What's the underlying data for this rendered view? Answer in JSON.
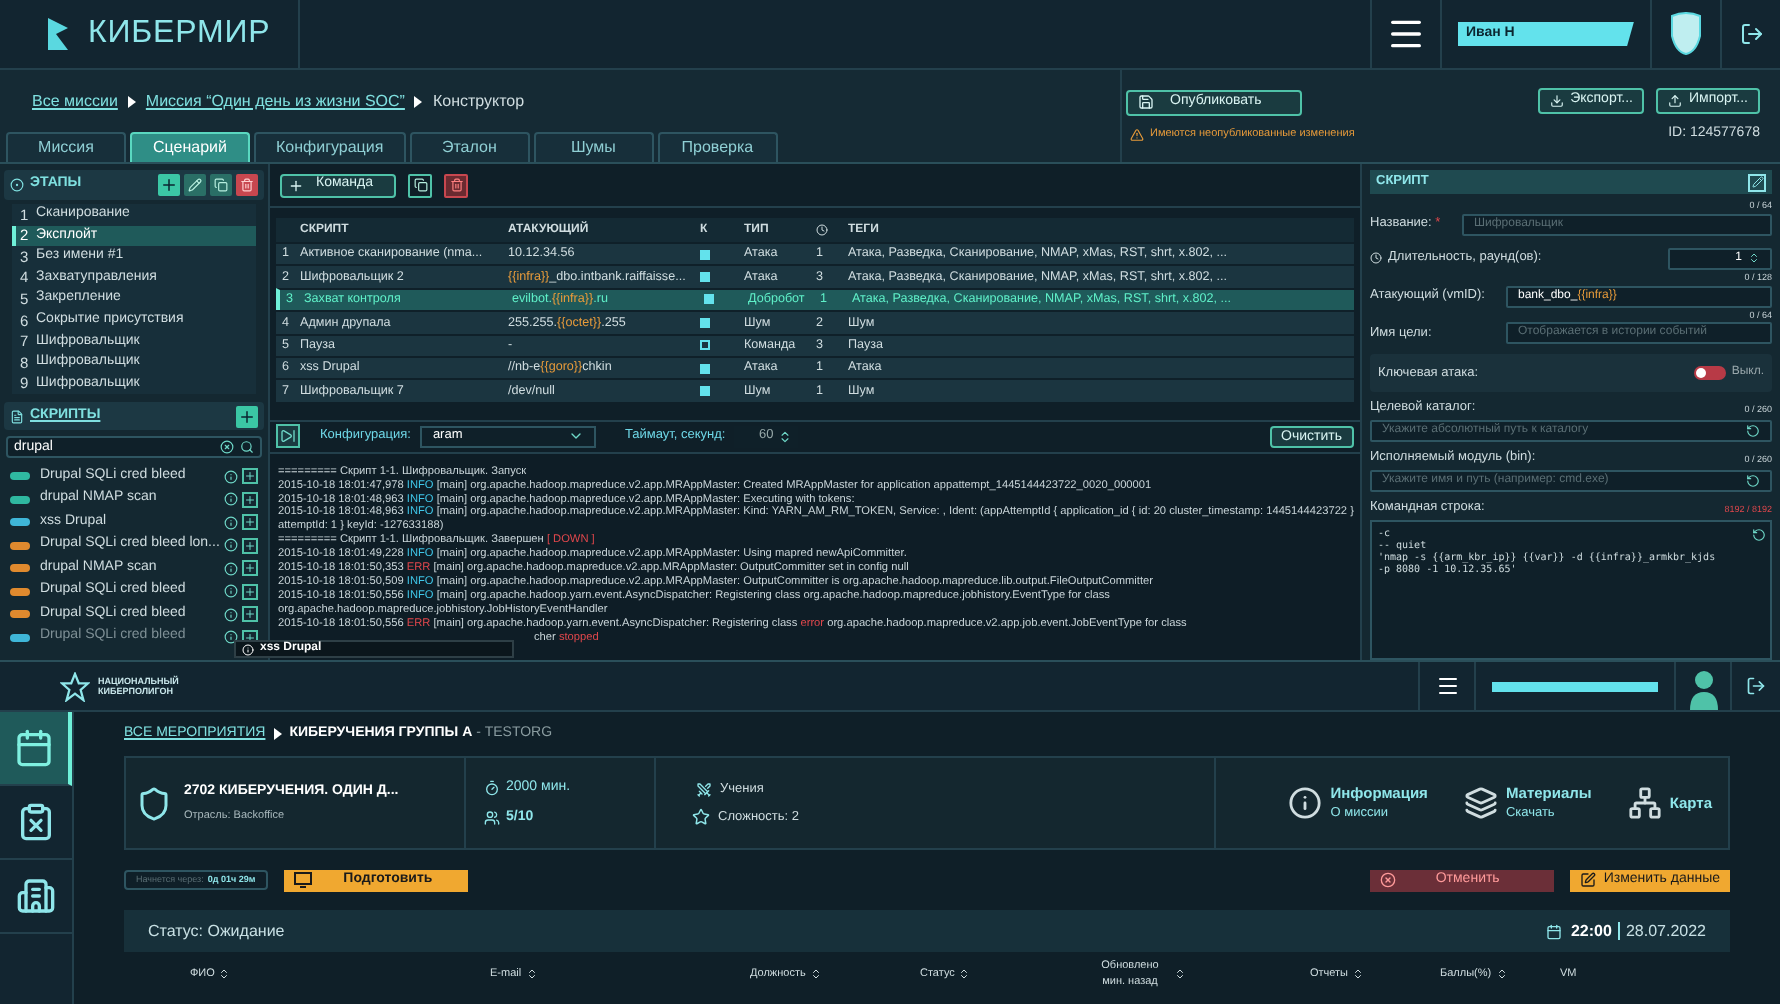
{
  "header": {
    "brand": "КИБЕРМИР",
    "user": "Иван Н"
  },
  "breadcrumb": [
    "Все миссии",
    "Миссия “Один день из жизни SOC”",
    "Конструктор"
  ],
  "publish": {
    "label": "Опубликовать",
    "warning": "Имеются неопубликованные изменения"
  },
  "export": "Экспорт...",
  "import": "Импорт...",
  "mission_id": "ID: 124577678",
  "tabs": [
    {
      "label": "Миссия",
      "selected": false
    },
    {
      "label": "Сценарий",
      "selected": true
    },
    {
      "label": "Конфигурация",
      "selected": false
    },
    {
      "label": "Эталон",
      "selected": false
    },
    {
      "label": "Шумы",
      "selected": false
    },
    {
      "label": "Проверка",
      "selected": false
    }
  ],
  "stages": {
    "title": "ЭТАПЫ",
    "items": [
      {
        "num": "1",
        "label": "Сканирование",
        "selected": false
      },
      {
        "num": "2",
        "label": "Эксплойт",
        "selected": true
      },
      {
        "num": "3",
        "label": "Без имени #1",
        "selected": false
      },
      {
        "num": "4",
        "label": "Захватуправления",
        "selected": false
      },
      {
        "num": "5",
        "label": "Закрепление",
        "selected": false
      },
      {
        "num": "6",
        "label": "Сокрытие присутствия",
        "selected": false
      },
      {
        "num": "7",
        "label": "Шифровальщик",
        "selected": false
      },
      {
        "num": "8",
        "label": "Шифровальщик",
        "selected": false
      },
      {
        "num": "9",
        "label": "Шифровальщик",
        "selected": false
      }
    ]
  },
  "scripts": {
    "title": "СКРИПТЫ",
    "search": "drupal",
    "items": [
      {
        "label": "Drupal SQLi cred bleed",
        "color": "#2fb8a0"
      },
      {
        "label": "drupal NMAP scan",
        "color": "#2fb8a0"
      },
      {
        "label": "xss Drupal",
        "color": "#3fb6d8"
      },
      {
        "label": "Drupal SQLi cred bleed lon...",
        "color": "#e08a2e"
      },
      {
        "label": "drupal NMAP scan",
        "color": "#e08a2e"
      },
      {
        "label": "Drupal SQLi cred bleed",
        "color": "#e08a2e"
      },
      {
        "label": "Drupal SQLi cred bleed",
        "color": "#e08a2e"
      },
      {
        "label": "Drupal SQLi cred bleed",
        "color": "#3fb6d8"
      }
    ]
  },
  "command_button": "Команда",
  "table": {
    "columns": [
      "СКРИПТ",
      "АТАКУЮЩИЙ",
      "К",
      "ТИП",
      "ТЕГИ"
    ],
    "rows": [
      {
        "num": "1",
        "script": "Активное сканирование (nma...",
        "attacker": [
          {
            "text": "10.12.34.56",
            "kind": "text"
          }
        ],
        "checked": true,
        "type": "Атака",
        "time": "1",
        "tags": "Атака, Разведка, Сканирование, NMAP, xMas, RST, shrt, x.802, ...",
        "selected": false
      },
      {
        "num": "2",
        "script": "Шифровальщик 2",
        "attacker": [
          {
            "text": "{{infra}}",
            "kind": "var"
          },
          {
            "text": "_dbo.intbank.raiffaisse...",
            "kind": "text"
          }
        ],
        "checked": true,
        "type": "Атака",
        "time": "3",
        "tags": "Атака, Разведка, Сканирование, NMAP, xMas, RST, shrt, x.802, ...",
        "selected": false
      },
      {
        "num": "3",
        "script": "Захват контроля",
        "attacker": [
          {
            "text": "evilbot.",
            "kind": "text"
          },
          {
            "text": "{{infra}}",
            "kind": "var"
          },
          {
            "text": ".ru",
            "kind": "text"
          }
        ],
        "checked": true,
        "type": "Добробот",
        "time": "1",
        "tags": "Атака, Разведка, Сканирование, NMAP, xMas, RST, shrt, x.802, ...",
        "selected": true
      },
      {
        "num": "4",
        "script": "Админ друпала",
        "attacker": [
          {
            "text": "255.255.",
            "kind": "text"
          },
          {
            "text": "{{octet}}",
            "kind": "var"
          },
          {
            "text": ".255",
            "kind": "text"
          }
        ],
        "checked": true,
        "type": "Шум",
        "time": "2",
        "tags": "Шум",
        "selected": false
      },
      {
        "num": "5",
        "script": "Пауза",
        "attacker": [
          {
            "text": "-",
            "kind": "text"
          }
        ],
        "checked": false,
        "type": "Команда",
        "time": "3",
        "tags": "Пауза",
        "selected": false
      },
      {
        "num": "6",
        "script": "xss Drupal",
        "attacker": [
          {
            "text": "//nb-e",
            "kind": "text"
          },
          {
            "text": "{{goro}}",
            "kind": "var"
          },
          {
            "text": "chkin",
            "kind": "text"
          }
        ],
        "checked": true,
        "type": "Атака",
        "time": "1",
        "tags": "Атака",
        "selected": false
      },
      {
        "num": "7",
        "script": "Шифровальщик 7",
        "attacker": [
          {
            "text": "/dev/null",
            "kind": "text"
          }
        ],
        "checked": true,
        "type": "Шум",
        "time": "1",
        "tags": "Шум",
        "selected": false
      }
    ]
  },
  "run_bar": {
    "config_label": "Конфигурация:",
    "config_value": "aram",
    "timeout_label": "Таймаут, секунд:",
    "timeout_value": "60",
    "clear": "Очистить"
  },
  "log": [
    [
      {
        "text": "========= Скрипт 1-1. Шифровальщик. Запуск",
        "kind": "text"
      }
    ],
    [
      {
        "text": "2015-10-18 18:01:47,978 ",
        "kind": "text"
      },
      {
        "text": "INFO",
        "kind": "info"
      },
      {
        "text": " [main] org.apache.hadoop.mapreduce.v2.app.MRAppMaster: Created MRAppMaster for application appattempt_1445144423722_0020_000001",
        "kind": "text"
      }
    ],
    [
      {
        "text": "2015-10-18 18:01:48,963 ",
        "kind": "text"
      },
      {
        "text": "INFO",
        "kind": "info"
      },
      {
        "text": " [main] org.apache.hadoop.mapreduce.v2.app.MRAppMaster: Executing with tokens:",
        "kind": "text"
      }
    ],
    [
      {
        "text": "2015-10-18 18:01:48,963 ",
        "kind": "text"
      },
      {
        "text": "INFO",
        "kind": "info"
      },
      {
        "text": " [main] org.apache.hadoop.mapreduce.v2.app.MRAppMaster: Kind: YARN_AM_RM_TOKEN, Service: , Ident: (appAttemptId { application_id { id: 20 cluster_timestamp: 1445144423722 }",
        "kind": "text"
      }
    ],
    [
      {
        "text": "attemptId: 1 } keyId: -127633188)",
        "kind": "text"
      }
    ],
    [
      {
        "text": "========= Скрипт 1-1. Шифровальщик. Завершен ",
        "kind": "text"
      },
      {
        "text": "[ DOWN ]",
        "kind": "err"
      }
    ],
    [
      {
        "text": "2015-10-18 18:01:49,228 ",
        "kind": "text"
      },
      {
        "text": "INFO",
        "kind": "info"
      },
      {
        "text": " [main] org.apache.hadoop.mapreduce.v2.app.MRAppMaster: Using mapred newApiCommitter.",
        "kind": "text"
      }
    ],
    [
      {
        "text": "2015-10-18 18:01:50,353 ",
        "kind": "text"
      },
      {
        "text": "ERR",
        "kind": "err"
      },
      {
        "text": " [main] org.apache.hadoop.mapreduce.v2.app.MRAppMaster: OutputCommitter set in config null",
        "kind": "text"
      }
    ],
    [
      {
        "text": "2015-10-18 18:01:50,509 ",
        "kind": "text"
      },
      {
        "text": "INFO",
        "kind": "info"
      },
      {
        "text": " [main] org.apache.hadoop.mapreduce.v2.app.MRAppMaster: OutputCommitter is org.apache.hadoop.mapreduce.lib.output.FileOutputCommitter",
        "kind": "text"
      }
    ],
    [
      {
        "text": "2015-10-18 18:01:50,556 ",
        "kind": "text"
      },
      {
        "text": "INFO",
        "kind": "info"
      },
      {
        "text": " [main] org.apache.hadoop.yarn.event.AsyncDispatcher: Registering class org.apache.hadoop.mapreduce.jobhistory.EventType for class",
        "kind": "text"
      }
    ],
    [
      {
        "text": "org.apache.hadoop.mapreduce.jobhistory.JobHistoryEventHandler",
        "kind": "text"
      }
    ],
    [
      {
        "text": "2015-10-18 18:01:50,556 ",
        "kind": "text"
      },
      {
        "text": "ERR",
        "kind": "err"
      },
      {
        "text": " [main] org.apache.hadoop.yarn.event.AsyncDispatcher: Registering class ",
        "kind": "text"
      },
      {
        "text": "error",
        "kind": "err"
      },
      {
        "text": " org.apache.hadoop.mapreduce.v2.app.job.event.JobEventType for class",
        "kind": "text"
      }
    ],
    [
      {
        "text": "cher ",
        "kind": "text"
      },
      {
        "text": "stopped",
        "kind": "err"
      }
    ]
  ],
  "tooltip": "xss Drupal",
  "script_form": {
    "title": "СКРИПТ",
    "name": {
      "label": "Название:",
      "required": "*",
      "placeholder": "Шифровальщик",
      "counter": "0 / 64"
    },
    "duration": {
      "label": "Длительность, раунд(ов):",
      "value": "1"
    },
    "attacker": {
      "label": "Атакующий (vmID):",
      "counter": "0 / 128",
      "value": [
        {
          "text": "bank_dbo_",
          "kind": "text"
        },
        {
          "text": "{{infra}}",
          "kind": "var"
        }
      ]
    },
    "target": {
      "label": "Имя цели:",
      "counter": "0 / 64",
      "placeholder": "Отображается в истории событий"
    },
    "key_attack": {
      "label": "Ключевая атака:",
      "on": false,
      "state": "Выкл."
    },
    "catalog": {
      "label": "Целевой каталог:",
      "counter": "0 / 260",
      "placeholder": "Укажите абсолютный путь к каталогу"
    },
    "module": {
      "label": "Исполняемый модуль (bin):",
      "counter": "0 / 260",
      "placeholder": "Укажите имя и путь (например: cmd.exe)"
    },
    "cmd": {
      "label": "Командная строка:",
      "counter": "8192 / 8192",
      "lines": [
        "-c",
        "-- quiet",
        "'nmap -s {{arm_kbr_ip}} {{var}} -d {{infra}}_armkbr_kjds",
        "-p 8080 -1 10.12.35.65'"
      ]
    }
  },
  "portal": {
    "logo_lines": [
      "НАЦИОНАЛЬНЫЙ",
      "КИБЕРПОЛИГОН"
    ],
    "nav": [
      {
        "kind": "calendar",
        "selected": true
      },
      {
        "kind": "report",
        "selected": false
      },
      {
        "kind": "building",
        "selected": false
      }
    ],
    "breadcrumb": {
      "link": "ВСЕ МЕРОПРИЯТИЯ",
      "current": "КИБЕРУЧЕНИЯ ГРУППЫ А",
      "org": " - TESTORG"
    },
    "event": {
      "title": "2702 КИБЕРУЧЕНИЯ. ОДИН Д...",
      "industry": "Отрасль: Backoffice",
      "duration": "2000 мин.",
      "teams": "5/10",
      "kind": "Учения",
      "difficulty": "Сложность: 2",
      "links": [
        {
          "kind": "info",
          "title": "Информация",
          "sub": "О миссии"
        },
        {
          "kind": "files",
          "title": "Материалы",
          "sub": "Скачать"
        },
        {
          "kind": "map",
          "title": "Карта"
        }
      ]
    },
    "starts_label": "Начнется через:",
    "starts_value": "0д 01ч 29м",
    "prepare": "Подготовить",
    "cancel": "Отменить",
    "edit": "Изменить данные",
    "status": "Статус: Ожидание",
    "time": "22:00",
    "date": "28.07.2022",
    "columns": [
      {
        "label": "ФИО",
        "sortable": true
      },
      {
        "label": "E-mail",
        "sortable": true
      },
      {
        "label": "Должность",
        "sortable": true
      },
      {
        "label": "Статус",
        "sortable": true
      },
      {
        "label": "Обновлено мин. назад",
        "sortable": true
      },
      {
        "label": "Отчеты",
        "sortable": true
      },
      {
        "label": "Баллы(%)",
        "sortable": true
      },
      {
        "label": "VM",
        "sortable": false
      }
    ]
  }
}
